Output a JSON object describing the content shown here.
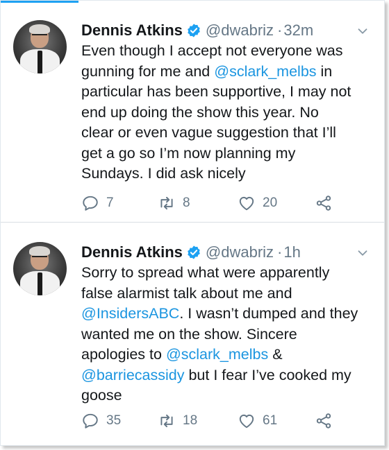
{
  "tweets": [
    {
      "name": "Dennis Atkins",
      "handle": "@dwabriz",
      "time": "32m",
      "lines": [
        [
          {
            "t": "Even though I accept not everyone was"
          }
        ],
        [
          {
            "t": "gunning for me and "
          },
          {
            "t": "@sclark_melbs",
            "m": true
          },
          {
            "t": " in"
          }
        ],
        [
          {
            "t": "particular has been supportive, I may not"
          }
        ],
        [
          {
            "t": "end up doing the show this year. No"
          }
        ],
        [
          {
            "t": "clear or even vague suggestion that I’ll"
          }
        ],
        [
          {
            "t": "get a go so I’m now planning my"
          }
        ],
        [
          {
            "t": "Sundays. I did ask nicely"
          }
        ]
      ],
      "replies": "7",
      "retweets": "8",
      "likes": "20"
    },
    {
      "name": "Dennis Atkins",
      "handle": "@dwabriz",
      "time": "1h",
      "lines": [
        [
          {
            "t": "Sorry to spread what were apparently"
          }
        ],
        [
          {
            "t": "false alarmist talk about me and"
          }
        ],
        [
          {
            "t": "@InsidersABC",
            "m": true
          },
          {
            "t": ". I wasn’t dumped and they"
          }
        ],
        [
          {
            "t": "wanted me on the show. Sincere"
          }
        ],
        [
          {
            "t": "apologies to "
          },
          {
            "t": "@sclark_melbs",
            "m": true
          },
          {
            "t": " &"
          }
        ],
        [
          {
            "t": "@barriecassidy",
            "m": true
          },
          {
            "t": " but I fear I’ve cooked my"
          }
        ],
        [
          {
            "t": "goose"
          }
        ]
      ],
      "replies": "35",
      "retweets": "18",
      "likes": "61"
    }
  ],
  "colors": {
    "accent": "#1b95e0",
    "verified": "#1da1f2",
    "muted": "#657786",
    "text": "#14171a"
  },
  "icons": {
    "reply": "reply-icon",
    "retweet": "retweet-icon",
    "like": "heart-icon",
    "share": "share-icon",
    "menu": "chevron-down-icon",
    "badge": "verified-badge-icon"
  }
}
